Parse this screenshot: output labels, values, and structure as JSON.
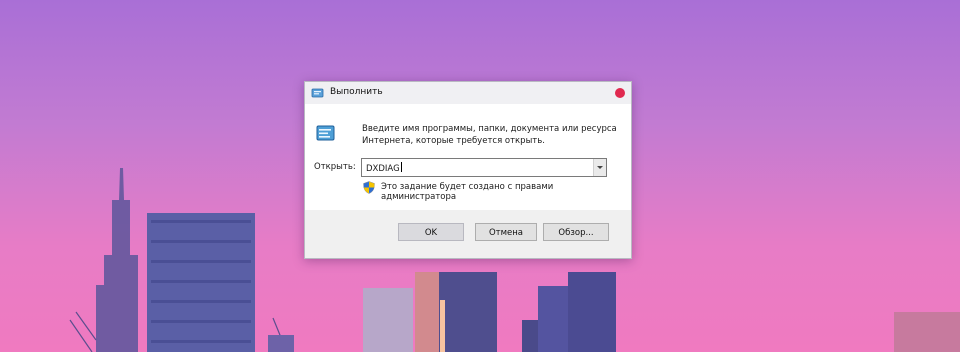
{
  "dialog": {
    "title": "Выполнить",
    "description_line1": "Введите имя программы, папки, документа или ресурса",
    "description_line2": "Интернета, которые требуется открыть.",
    "open_label": "Открыть:",
    "open_value": "DXDIAG",
    "admin_note": "Это задание будет создано с правами администратора",
    "buttons": {
      "ok": "OK",
      "cancel": "Отмена",
      "browse": "Обзор..."
    }
  },
  "colors": {
    "close_button": "#e0294f",
    "sky_top": "#a96fd6",
    "sky_bottom": "#f07ac0"
  },
  "icons": {
    "title": "run-icon",
    "body": "run-icon",
    "admin": "uac-shield-icon",
    "close": "close-icon"
  }
}
